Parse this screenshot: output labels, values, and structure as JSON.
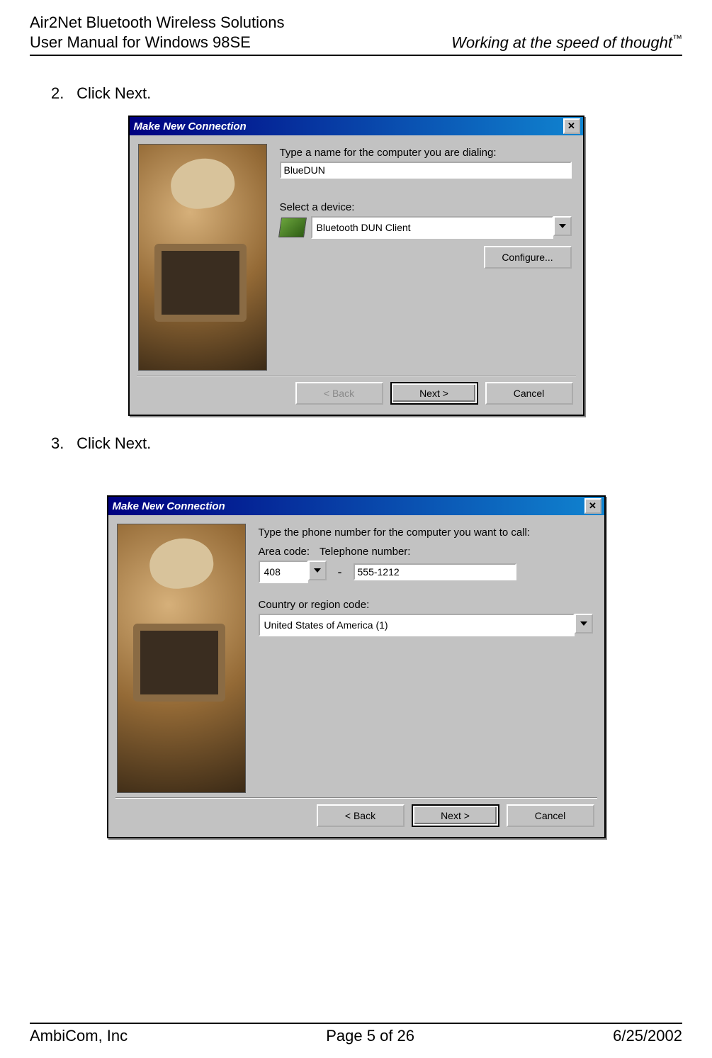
{
  "header": {
    "line1": "Air2Net Bluetooth Wireless Solutions",
    "line2": "User Manual for Windows 98SE",
    "tagline": "Working at the speed of thought",
    "tm": "™"
  },
  "steps": {
    "s2_num": "2.",
    "s2_text": "Click Next.",
    "s3_num": "3.",
    "s3_text": "Click Next."
  },
  "dialog1": {
    "title": "Make New Connection",
    "label_name": "Type a name for the computer you are dialing:",
    "value_name": "BlueDUN",
    "label_device": "Select a device:",
    "device_value": "Bluetooth DUN Client",
    "btn_configure": "Configure...",
    "btn_back": "< Back",
    "btn_next": "Next >",
    "btn_cancel": "Cancel"
  },
  "dialog2": {
    "title": "Make New Connection",
    "label_intro": "Type the phone number for the computer you want to call:",
    "label_area": "Area code:",
    "area_value": "408",
    "label_tel": "Telephone number:",
    "tel_value": "555-1212",
    "label_country": "Country or region code:",
    "country_value": "United States of America (1)",
    "btn_back": "< Back",
    "btn_next": "Next >",
    "btn_cancel": "Cancel"
  },
  "footer": {
    "left": "AmbiCom, Inc",
    "center": "Page 5 of 26",
    "right": "6/25/2002"
  }
}
